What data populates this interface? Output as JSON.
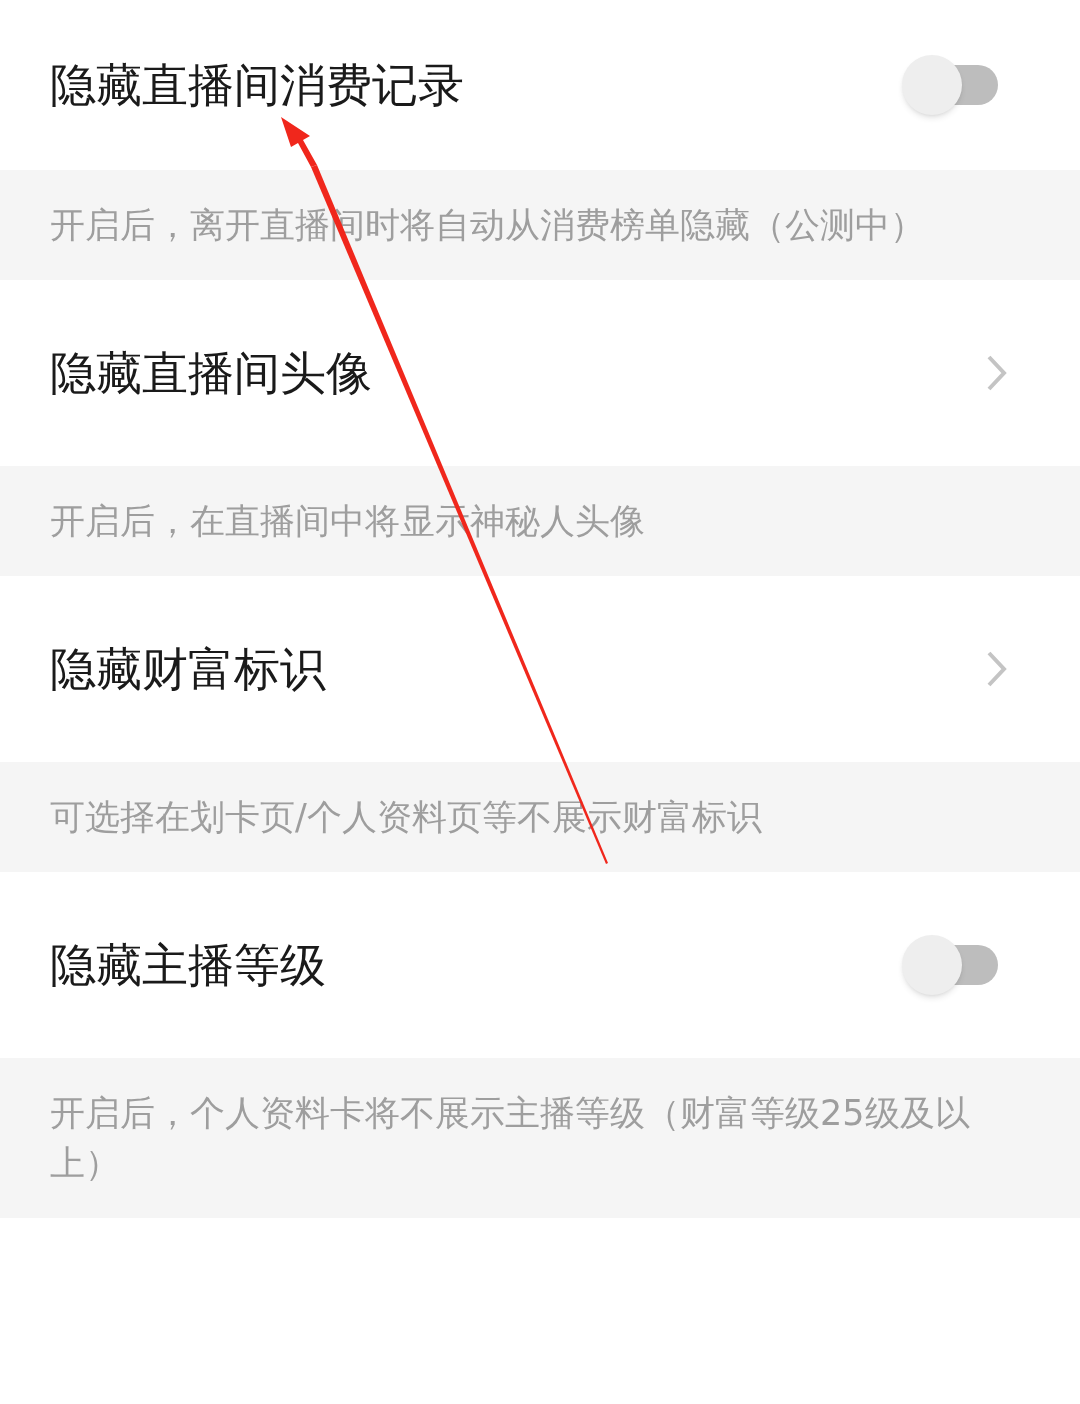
{
  "settings": [
    {
      "kind": "toggle",
      "label": "隐藏直播间消费记录",
      "on": false,
      "description": "开启后，离开直播间时将自动从消费榜单隐藏（公测中）"
    },
    {
      "kind": "link",
      "label": "隐藏直播间头像",
      "description": "开启后，在直播间中将显示神秘人头像"
    },
    {
      "kind": "link",
      "label": "隐藏财富标识",
      "description": "可选择在划卡页/个人资料页等不展示财富标识"
    },
    {
      "kind": "toggle",
      "label": "隐藏主播等级",
      "on": false,
      "description": "开启后，个人资料卡将不展示主播等级（财富等级25级及以上）"
    }
  ]
}
